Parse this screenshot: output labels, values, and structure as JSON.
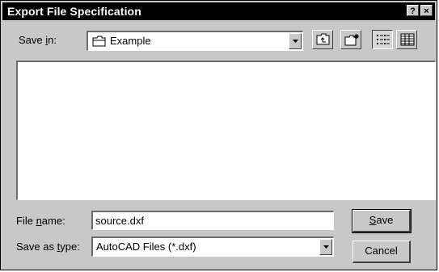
{
  "window": {
    "title": "Export File Specification",
    "help_button": "?",
    "close_button": "×"
  },
  "save_in": {
    "label_pre": "Save ",
    "label_accel": "i",
    "label_post": "n:",
    "value": "Example",
    "icon": "folder-icon"
  },
  "toolbar": {
    "icons": [
      "up-one-level-icon",
      "create-new-folder-icon",
      "list-view-icon",
      "details-view-icon"
    ],
    "active_view": "list"
  },
  "file_list": {
    "items": []
  },
  "file_name": {
    "label_pre": "File ",
    "label_accel": "n",
    "label_post": "ame:",
    "value": "source.dxf"
  },
  "save_as_type": {
    "label_pre": "Save as ",
    "label_accel": "t",
    "label_post": "ype:",
    "value": "AutoCAD Files (*.dxf)"
  },
  "buttons": {
    "save_accel": "S",
    "save_rest": "ave",
    "cancel": "Cancel"
  }
}
